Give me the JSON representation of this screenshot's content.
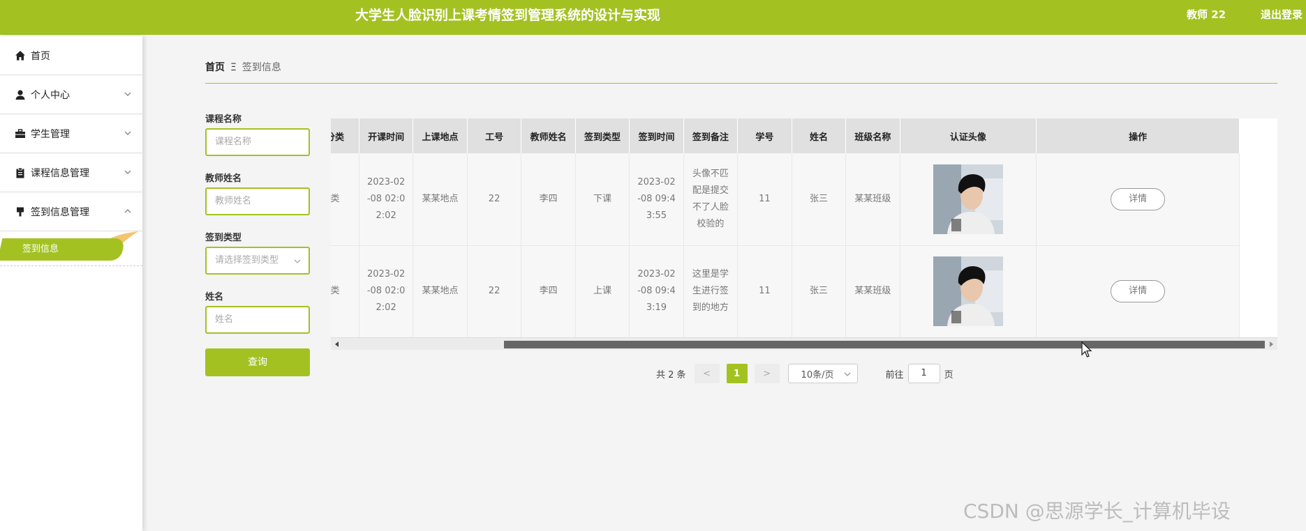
{
  "header": {
    "title": "大学生人脸识别上课考情签到管理系统的设计与实现",
    "user": "教师 22",
    "logout": "退出登录"
  },
  "sidebar": {
    "items": [
      {
        "label": "首页",
        "icon": "home-icon"
      },
      {
        "label": "个人中心",
        "icon": "user-icon"
      },
      {
        "label": "学生管理",
        "icon": "briefcase-icon"
      },
      {
        "label": "课程信息管理",
        "icon": "clipboard-icon"
      },
      {
        "label": "签到信息管理",
        "icon": "brush-icon"
      }
    ],
    "active_sub": "签到信息"
  },
  "breadcrumb": {
    "home": "首页",
    "sep": "Ξ",
    "current": "签到信息"
  },
  "search": {
    "course_label": "课程名称",
    "course_placeholder": "课程名称",
    "teacher_label": "教师姓名",
    "teacher_placeholder": "教师姓名",
    "type_label": "签到类型",
    "type_placeholder": "请选择签到类型",
    "name_label": "姓名",
    "name_placeholder": "姓名",
    "button": "查询"
  },
  "table": {
    "headers": [
      "课程分类",
      "开课时间",
      "上课地点",
      "工号",
      "教师姓名",
      "签到类型",
      "签到时间",
      "签到备注",
      "学号",
      "姓名",
      "班级名称",
      "认证头像",
      "操作"
    ],
    "rows": [
      {
        "category": "外语类",
        "start": "2023-02-08 02:02:02",
        "place": "某某地点",
        "id": "22",
        "teacher": "李四",
        "type": "下课",
        "time": "2023-02-08 09:43:55",
        "note": "头像不匹配是提交不了人脸校验的",
        "sno": "11",
        "name": "张三",
        "class": "某某班级",
        "action": "详情"
      },
      {
        "category": "外语类",
        "start": "2023-02-08 02:02:02",
        "place": "某某地点",
        "id": "22",
        "teacher": "李四",
        "type": "上课",
        "time": "2023-02-08 09:43:19",
        "note": "这里是学生进行签到的地方",
        "sno": "11",
        "name": "张三",
        "class": "某某班级",
        "action": "详情"
      }
    ]
  },
  "pager": {
    "total": "共 2 条",
    "prev": "<",
    "current": "1",
    "next": ">",
    "size": "10条/页",
    "goto": "前往",
    "page_input": "1",
    "page_suffix": "页"
  },
  "watermark": "CSDN @思源学长_计算机毕设",
  "colors": {
    "accent": "#a3c222"
  }
}
